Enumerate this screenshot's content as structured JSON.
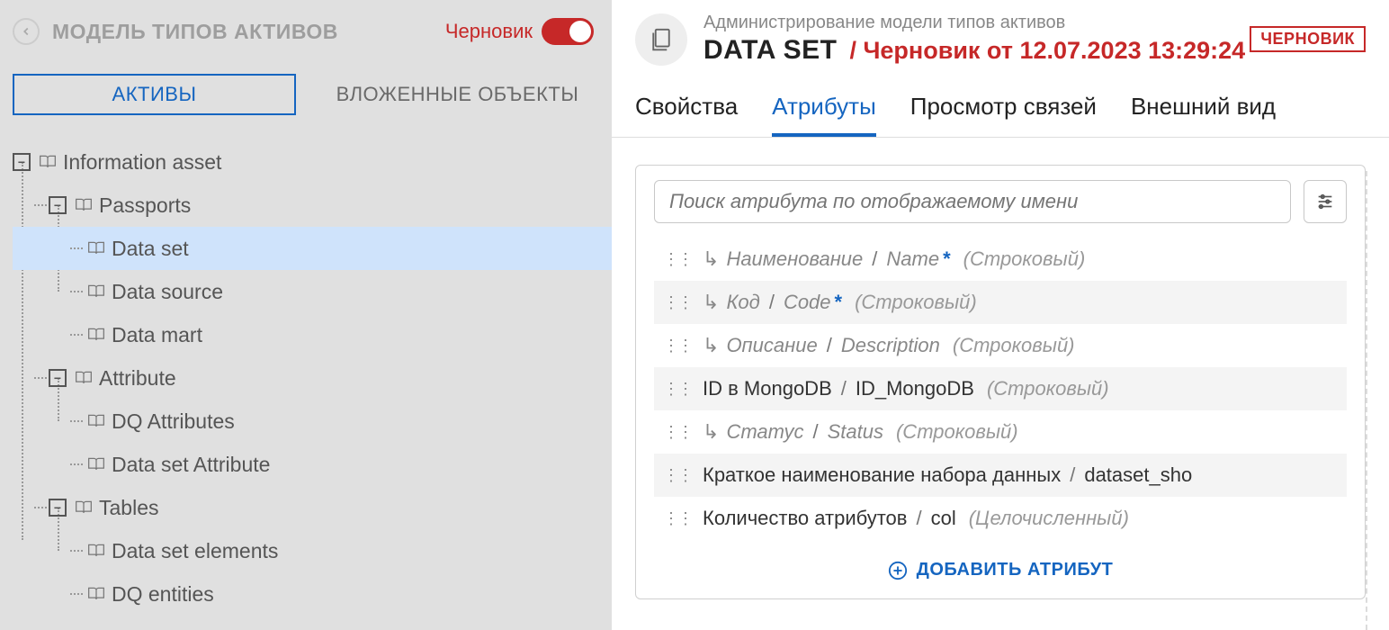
{
  "left": {
    "title": "МОДЕЛЬ ТИПОВ АКТИВОВ",
    "toggle_label": "Черновик",
    "tabs": {
      "assets": "АКТИВЫ",
      "nested": "ВЛОЖЕННЫЕ ОБЪЕКТЫ"
    }
  },
  "tree": {
    "root": "Information asset",
    "passports": "Passports",
    "data_set": "Data set",
    "data_source": "Data source",
    "data_mart": "Data mart",
    "attribute": "Attribute",
    "dq_attributes": "DQ Attributes",
    "data_set_attribute": "Data set Attribute",
    "tables": "Tables",
    "data_set_elements": "Data set elements",
    "dq_entities": "DQ entities"
  },
  "right": {
    "breadcrumb": "Администрирование модели типов активов",
    "title": "DATA SET",
    "draft_info": "/ Черновик от 12.07.2023 13:29:24",
    "badge": "ЧЕРНОВИК",
    "tabs": {
      "props": "Свойства",
      "attrs": "Атрибуты",
      "links": "Просмотр связей",
      "appearance": "Внешний вид"
    },
    "search_placeholder": "Поиск атрибута по отображаемому имени",
    "add_attr": "ДОБАВИТЬ АТРИБУТ"
  },
  "attrs": [
    {
      "inherited": true,
      "ru": "Наименование",
      "sep": "/",
      "code": "Name",
      "req": "*",
      "type": "(Строковый)",
      "alt": false,
      "plain": false
    },
    {
      "inherited": true,
      "ru": "Код",
      "sep": "/",
      "code": "Code",
      "req": "*",
      "type": "(Строковый)",
      "alt": true,
      "plain": false
    },
    {
      "inherited": true,
      "ru": "Описание",
      "sep": "/",
      "code": "Description",
      "req": "",
      "type": "(Строковый)",
      "alt": false,
      "plain": false
    },
    {
      "inherited": false,
      "ru": "ID в MongoDB",
      "sep": "/",
      "code": "ID_MongoDB",
      "req": "",
      "type": "(Строковый)",
      "alt": true,
      "plain": true
    },
    {
      "inherited": true,
      "ru": "Статус",
      "sep": "/",
      "code": "Status",
      "req": "",
      "type": "(Строковый)",
      "alt": false,
      "plain": false
    },
    {
      "inherited": false,
      "ru": "Краткое наименование набора данных",
      "sep": "/",
      "code": "dataset_sho",
      "req": "",
      "type": "",
      "alt": true,
      "plain": true
    },
    {
      "inherited": false,
      "ru": "Количество атрибутов",
      "sep": "/",
      "code": "col",
      "req": "",
      "type": "(Целочисленный)",
      "alt": false,
      "plain": true
    }
  ]
}
